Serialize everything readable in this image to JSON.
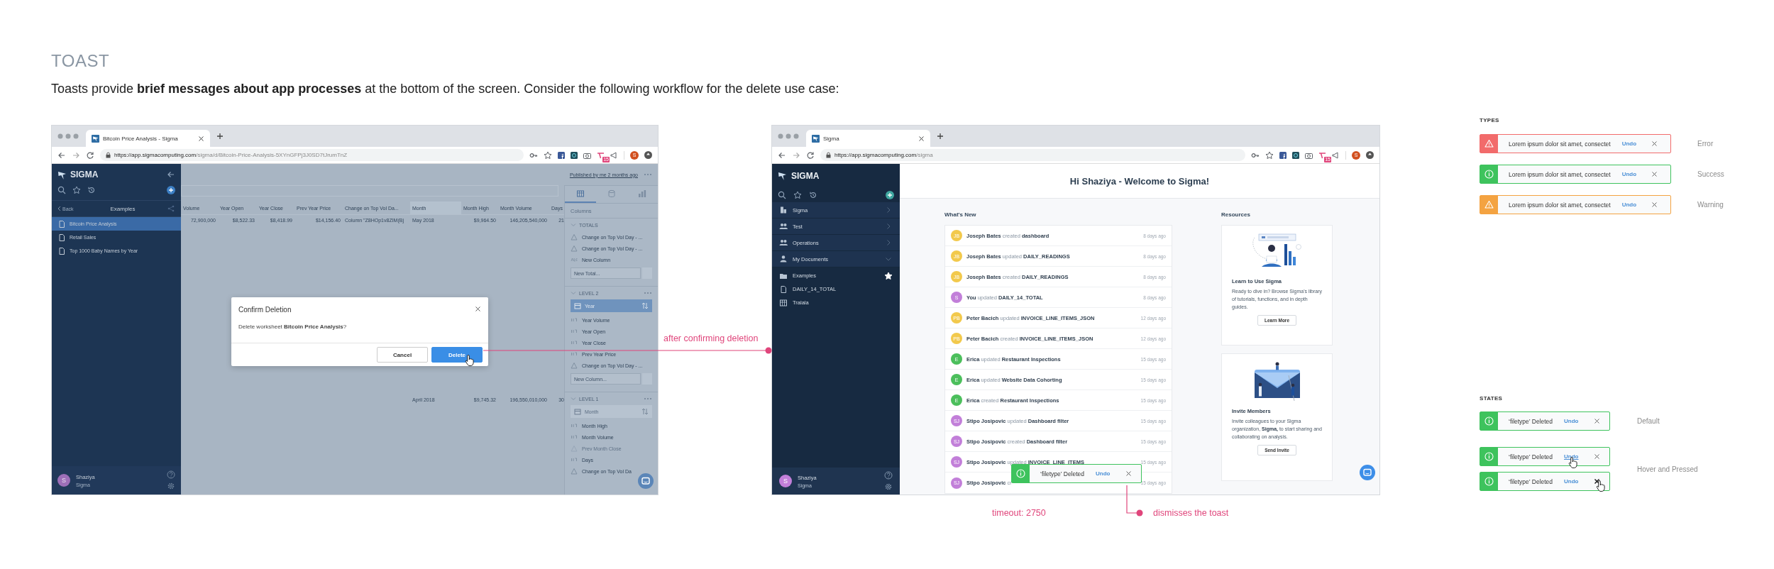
{
  "heading": "TOAST",
  "intro": "Toasts provide **brief messages about app processes** at the bottom of the screen. Consider the following workflow for the delete use case:",
  "delete_screen": {
    "tab_title": "Bitcoin Price Analysis - Sigma",
    "url": {
      "host": "https://app.sigmacomputing.com",
      "path": "/sigma/d/Bitcoin-Price-Analysis-5XYnGFPj3J0SD7tJrumTnZ"
    },
    "profile_initial": "S",
    "extension_badge": "15",
    "sidebar": {
      "brand": "SIGMA",
      "back": "Back",
      "folder": "Examples",
      "items": [
        {
          "label": "Bitcoin Price Analysis",
          "selected": true
        },
        {
          "label": "Retail Sales",
          "selected": false
        },
        {
          "label": "Top 1000 Baby Names by Year",
          "selected": false
        }
      ]
    },
    "user": {
      "initial": "S",
      "name": "Shaziya",
      "org": "Sigma"
    },
    "published": "Published by me 2 months ago",
    "table": {
      "columns": [
        "Volume",
        "Year Open",
        "Year Close",
        "Prev Year Price",
        "Change on Top Vol Da...",
        "Month",
        "Month High",
        "Month Volume",
        "Days"
      ],
      "rows": [
        [
          "72,900,000",
          "$8,522.33",
          "$8,418.99",
          "$14,156.40",
          "Column \"Z8HOp1v8ZIM(Bj",
          "May 2018",
          "$9,964.50",
          "146,205,540,000",
          "21"
        ],
        [
          null,
          null,
          null,
          null,
          null,
          "April 2018",
          "$9,745.32",
          "196,550,010,000",
          "30"
        ]
      ]
    },
    "columns_panel": {
      "tabs": [
        {
          "selected": true
        },
        {
          "selected": false
        },
        {
          "selected": false
        }
      ],
      "title": "Columns",
      "groups": [
        {
          "title": "TOTALS",
          "items": [
            {
              "label": "Change on Top Vol Day - ...",
              "kind": "calc",
              "disabled": false
            },
            {
              "label": "Change on Top Vol Day - ...",
              "kind": "calc",
              "disabled": false
            },
            {
              "label": "New Column",
              "kind": "text",
              "disabled": false
            }
          ],
          "new_field": {
            "placeholder": "New Total..."
          }
        },
        {
          "title": "LEVEL 2",
          "key": {
            "label": "Year",
            "selected": true
          },
          "items": [
            {
              "label": "Year Volume",
              "kind": "number",
              "disabled": false
            },
            {
              "label": "Year Open",
              "kind": "number",
              "disabled": false
            },
            {
              "label": "Year Close",
              "kind": "number",
              "disabled": false
            },
            {
              "label": "Prev Year Price",
              "kind": "number",
              "disabled": false
            },
            {
              "label": "Change on Top Vol Day - ...",
              "kind": "calc",
              "disabled": false
            }
          ],
          "new_field": {
            "placeholder": "New Column..."
          }
        },
        {
          "title": "LEVEL 1",
          "key": {
            "label": "Month",
            "selected": false
          },
          "items": [
            {
              "label": "Month High",
              "kind": "number",
              "disabled": false
            },
            {
              "label": "Month Volume",
              "kind": "number",
              "disabled": false
            },
            {
              "label": "Prev Month Close",
              "kind": "calc",
              "disabled": true
            },
            {
              "label": "Days",
              "kind": "number",
              "disabled": false
            },
            {
              "label": "Change on Top Vol Da",
              "kind": "calc",
              "disabled": false
            }
          ]
        }
      ]
    },
    "dialog": {
      "title": "Confirm Deletion",
      "message": "Delete worksheet **Bitcoin Price Analysis**?",
      "cancel": "Cancel",
      "confirm": "Delete",
      "confirm_hovered": true
    }
  },
  "home_screen": {
    "tab_title": "Sigma",
    "url": {
      "host": "https://app.sigmacomputing.com",
      "path": "/sigma"
    },
    "profile_initial": "S",
    "extension_badge": "15",
    "sidebar": {
      "brand": "SIGMA",
      "nav": [
        {
          "label": "Sigma",
          "kind": "org",
          "expanded": false
        },
        {
          "label": "Test",
          "kind": "team",
          "expanded": false
        },
        {
          "label": "Operations",
          "kind": "team",
          "expanded": false
        },
        {
          "label": "My Documents",
          "kind": "personal",
          "expanded": true
        }
      ],
      "documents": [
        {
          "label": "Examples",
          "kind": "folder",
          "starred": true
        },
        {
          "label": "DAILY_14_TOTAL",
          "kind": "document",
          "starred": false
        },
        {
          "label": "Tralala",
          "kind": "table",
          "starred": false
        }
      ]
    },
    "user": {
      "initial": "S",
      "name": "Shaziya",
      "org": "Sigma"
    },
    "greeting": "Hi Shaziya - Welcome to Sigma!",
    "whats_new": {
      "title": "What's New",
      "items": [
        {
          "initials": "JB",
          "color": "#f2c94c",
          "text": "**Joseph Bates** created **dashboard**",
          "time": "8 days ago"
        },
        {
          "initials": "JB",
          "color": "#f2c94c",
          "text": "**Joseph Bates** updated **DAILY_READINGS**",
          "time": "8 days ago"
        },
        {
          "initials": "JB",
          "color": "#f2c94c",
          "text": "**Joseph Bates** created **DAILY_READINGS**",
          "time": "8 days ago"
        },
        {
          "initials": "S",
          "color": "#c27fd9",
          "text": "**You** updated **DAILY_14_TOTAL**",
          "time": "8 days ago"
        },
        {
          "initials": "PB",
          "color": "#f2c94c",
          "text": "**Peter Bacich** updated **INVOICE_LINE_ITEMS_JSON**",
          "time": "12 days ago"
        },
        {
          "initials": "PB",
          "color": "#f2c94c",
          "text": "**Peter Bacich** created **INVOICE_LINE_ITEMS_JSON**",
          "time": "12 days ago"
        },
        {
          "initials": "E",
          "color": "#4cbf5c",
          "text": "**Erica** updated **Restaurant Inspections**",
          "time": "15 days ago"
        },
        {
          "initials": "E",
          "color": "#4cbf5c",
          "text": "**Erica** updated **Website Data Cohorting**",
          "time": "15 days ago"
        },
        {
          "initials": "E",
          "color": "#4cbf5c",
          "text": "**Erica** created **Restaurant Inspections**",
          "time": "15 days ago"
        },
        {
          "initials": "SJ",
          "color": "#c27fd9",
          "text": "**Stipo Josipovic** updated **Dashboard filter**",
          "time": "15 days ago"
        },
        {
          "initials": "SJ",
          "color": "#c27fd9",
          "text": "**Stipo Josipovic** created **Dashboard filter**",
          "time": "15 days ago"
        },
        {
          "initials": "SJ",
          "color": "#c27fd9",
          "text": "**Stipo Josipovic** updated **INVOICE_LINE_ITEMS**",
          "time": "15 days ago"
        },
        {
          "initials": "SJ",
          "color": "#c27fd9",
          "text": "**Stipo Josipovic** cr",
          "time": "15 days ago"
        }
      ]
    },
    "resources": {
      "title": "Resources",
      "cards": [
        {
          "title": "Learn to Use Sigma",
          "text": "Ready to dive in? Browse Sigma's library of tutorials, functions, and in depth guides.",
          "button": "Learn More"
        },
        {
          "title": "Invite Members",
          "text": "Invite colleagues to your Sigma organization, **Sigma,** to start sharing and collaborating on analysis.",
          "button": "Send Invite"
        }
      ]
    },
    "toast": {
      "kind": "success",
      "message": "‘filetype’ Deleted",
      "action": "Undo"
    }
  },
  "annotations": {
    "after_delete": "after confirming deletion",
    "timeout": "timeout: 2750",
    "dismiss": "dismisses the toast"
  },
  "guide": {
    "types": {
      "title": "TYPES",
      "items": [
        {
          "kind": "error",
          "message": "Lorem ipsum dolor sit amet, consectet",
          "action": "Undo",
          "label": "Error"
        },
        {
          "kind": "success",
          "message": "Lorem ipsum dolor sit amet, consectet",
          "action": "Undo",
          "label": "Success"
        },
        {
          "kind": "warning",
          "message": "Lorem ipsum dolor sit amet, consectet",
          "action": "Undo",
          "label": "Warning"
        }
      ]
    },
    "states": {
      "title": "STATES",
      "groups": [
        {
          "label": "Default",
          "toasts": [
            {
              "kind": "success",
              "message": "‘filetype’ Deleted",
              "action": "Undo",
              "action_hovered": false,
              "close_hovered": false
            }
          ]
        },
        {
          "label": "Hover and Pressed",
          "toasts": [
            {
              "kind": "success",
              "message": "‘filetype’ Deleted",
              "action": "Undo",
              "action_hovered": true,
              "close_hovered": false
            },
            {
              "kind": "success",
              "message": "‘filetype’ Deleted",
              "action": "Undo",
              "action_hovered": false,
              "close_hovered": true
            }
          ]
        }
      ]
    }
  }
}
